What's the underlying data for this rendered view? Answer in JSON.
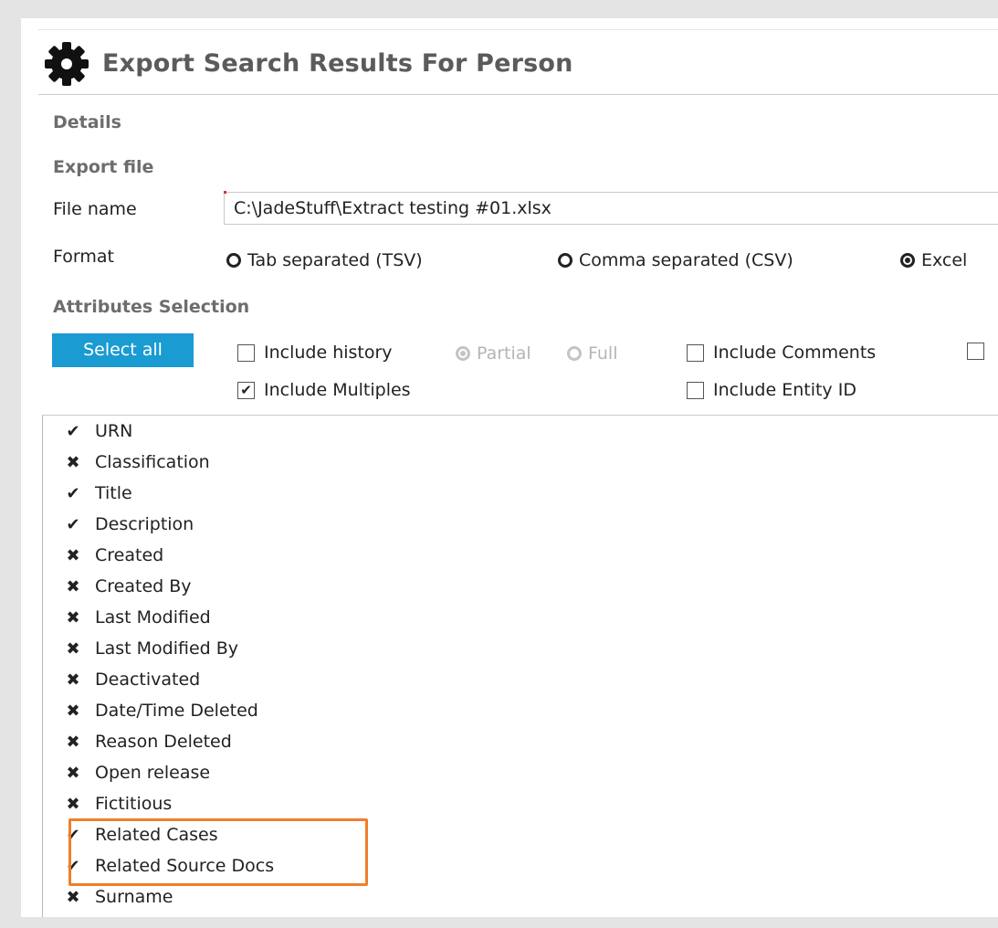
{
  "title": "Export Search Results For Person",
  "sections": {
    "details": "Details",
    "export_file": "Export file",
    "attributes_selection": "Attributes Selection"
  },
  "file": {
    "label": "File name",
    "value": "C:\\JadeStuff\\Extract testing #01.xlsx"
  },
  "format": {
    "label": "Format",
    "options": [
      {
        "label": "Tab separated (TSV)",
        "checked": false
      },
      {
        "label": "Comma separated (CSV)",
        "checked": false
      },
      {
        "label": "Excel",
        "checked": true
      }
    ]
  },
  "select_all_label": "Select all",
  "options": {
    "include_history": {
      "label": "Include history",
      "checked": false
    },
    "history_partial": {
      "label": "Partial",
      "checked": true,
      "disabled": true
    },
    "history_full": {
      "label": "Full",
      "checked": false,
      "disabled": true
    },
    "include_comments": {
      "label": "Include Comments",
      "checked": false
    },
    "include_multiples": {
      "label": "Include Multiples",
      "checked": true
    },
    "include_entity_id": {
      "label": "Include Entity ID",
      "checked": false
    }
  },
  "attributes": [
    {
      "label": "URN",
      "selected": true
    },
    {
      "label": "Classification",
      "selected": false
    },
    {
      "label": "Title",
      "selected": true
    },
    {
      "label": "Description",
      "selected": true
    },
    {
      "label": "Created",
      "selected": false
    },
    {
      "label": "Created By",
      "selected": false
    },
    {
      "label": "Last Modified",
      "selected": false
    },
    {
      "label": "Last Modified By",
      "selected": false
    },
    {
      "label": "Deactivated",
      "selected": false
    },
    {
      "label": "Date/Time Deleted",
      "selected": false
    },
    {
      "label": "Reason Deleted",
      "selected": false
    },
    {
      "label": "Open release",
      "selected": false
    },
    {
      "label": "Fictitious",
      "selected": false
    },
    {
      "label": "Related Cases",
      "selected": true
    },
    {
      "label": "Related Source Docs",
      "selected": true
    },
    {
      "label": "Surname",
      "selected": false
    }
  ],
  "colors": {
    "accent": "#1a9bd1",
    "highlight": "#f07f2a",
    "title_text": "#5b5b5b",
    "section_text": "#6d6d6d"
  }
}
